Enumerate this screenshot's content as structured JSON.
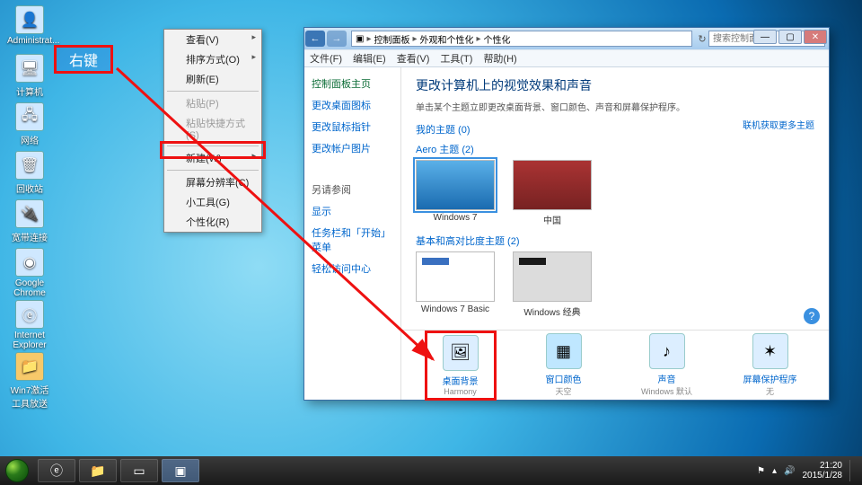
{
  "annot": {
    "right_click": "右键"
  },
  "desktop_icons": [
    {
      "label": "Administrat..."
    },
    {
      "label": "计算机"
    },
    {
      "label": "网络"
    },
    {
      "label": "回收站"
    },
    {
      "label": "宽带连接"
    },
    {
      "label": "Google Chrome"
    },
    {
      "label": "Internet Explorer"
    },
    {
      "label": "Win7激活工具放送"
    }
  ],
  "ctx_menu": {
    "view": "查看(V)",
    "sort": "排序方式(O)",
    "refresh": "刷新(E)",
    "paste": "粘贴(P)",
    "paste_shortcut": "粘贴快捷方式(S)",
    "new": "新建(W)",
    "resolution": "屏幕分辨率(C)",
    "gadgets": "小工具(G)",
    "personalize": "个性化(R)"
  },
  "win": {
    "crumb1": "控制面板",
    "crumb2": "外观和个性化",
    "crumb3": "个性化",
    "search_placeholder": "搜索控制面板",
    "menu": {
      "file": "文件(F)",
      "edit": "编辑(E)",
      "view": "查看(V)",
      "tools": "工具(T)",
      "help": "帮助(H)"
    },
    "side": {
      "home": "控制面板主页",
      "icons": "更改桌面图标",
      "pointers": "更改鼠标指针",
      "picture": "更改帐户图片",
      "see_also": "另请参阅",
      "display": "显示",
      "taskbar": "任务栏和「开始」菜单",
      "ease": "轻松访问中心"
    },
    "main": {
      "title": "更改计算机上的视觉效果和声音",
      "sub": "单击某个主题立即更改桌面背景、窗口颜色、声音和屏幕保护程序。",
      "my_themes": "我的主题 (0)",
      "more_online": "联机获取更多主题",
      "aero": "Aero 主题 (2)",
      "theme_w7": "Windows 7",
      "theme_cn": "中国",
      "basic": "基本和高对比度主题 (2)",
      "theme_basic": "Windows 7 Basic",
      "theme_classic": "Windows 经典"
    },
    "bottom": {
      "bg": {
        "t1": "桌面背景",
        "t2": "Harmony"
      },
      "color": {
        "t1": "窗口颜色",
        "t2": "天空"
      },
      "sound": {
        "t1": "声音",
        "t2": "Windows 默认"
      },
      "saver": {
        "t1": "屏幕保护程序",
        "t2": "无"
      }
    }
  },
  "taskbar": {
    "time": "21:20",
    "date": "2015/1/28"
  }
}
